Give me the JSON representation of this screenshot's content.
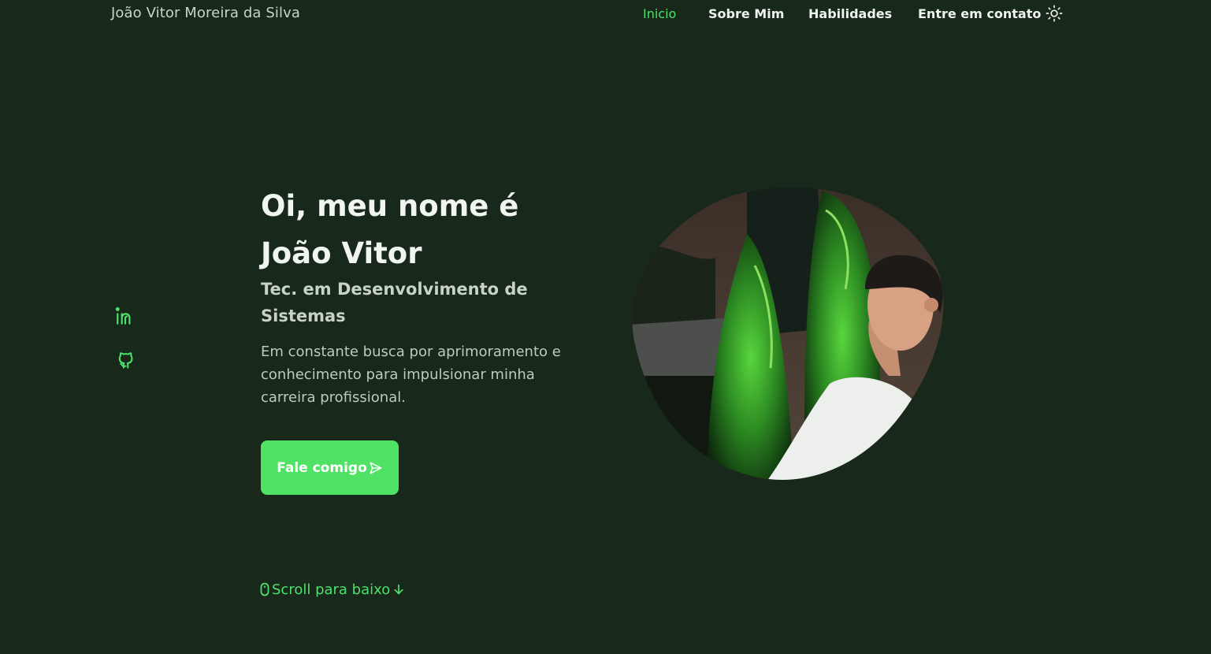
{
  "header": {
    "brand": "João Vitor Moreira da Silva",
    "nav": [
      "Inicio",
      "Sobre Mim",
      "Habilidades",
      "Entre em contato"
    ],
    "active_nav": "Inicio",
    "theme_icon": "sun-icon"
  },
  "socials": [
    {
      "name": "linkedin-icon"
    },
    {
      "name": "github-icon"
    }
  ],
  "hero": {
    "title_line1": "Oi, meu nome é",
    "title_line2": "João Vitor",
    "subtitle": "Tec. em Desenvolvimento de Sistemas",
    "description": "Em constante busca por aprimoramento e conhecimento para impulsionar minha carreira profissional.",
    "cta_label": "Fale comigo",
    "cta_icon": "send-icon",
    "scroll_label": "Scroll para baixo",
    "scroll_icons": [
      "mouse-icon",
      "arrow-down-icon"
    ]
  },
  "colors": {
    "background": "#18281a",
    "accent": "#4fe264",
    "text": "#f1f5f1",
    "muted": "#c8d2c9"
  }
}
